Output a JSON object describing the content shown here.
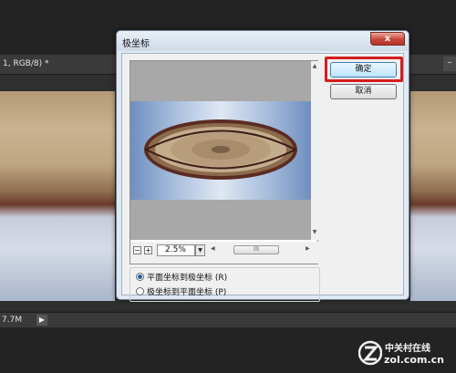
{
  "workspace": {
    "doc_tab_label": "1, RGB/8) *",
    "panel_min_glyph": "–",
    "status_size": "7.7M",
    "status_arrow": "▶"
  },
  "dialog": {
    "title": "极坐标",
    "close_glyph": "x",
    "ok_label": "确定",
    "cancel_label": "取消",
    "zoom_minus": "−",
    "zoom_plus": "+",
    "zoom_value": "2.5%",
    "zoom_dropdown_glyph": "▼",
    "scroll_left_glyph": "◀",
    "scroll_right_glyph": "▶",
    "scroll_up_glyph": "▲",
    "scroll_down_glyph": "▼",
    "scroll_thumb_grip": "III",
    "options": [
      {
        "label": "平面坐标到极坐标 (R)",
        "selected": true
      },
      {
        "label": "极坐标到平面坐标 (P)",
        "selected": false
      }
    ],
    "highlight_color": "#d51c1c"
  },
  "watermark": {
    "brand_cn": "中关村在线",
    "url": "zol.com.cn"
  }
}
